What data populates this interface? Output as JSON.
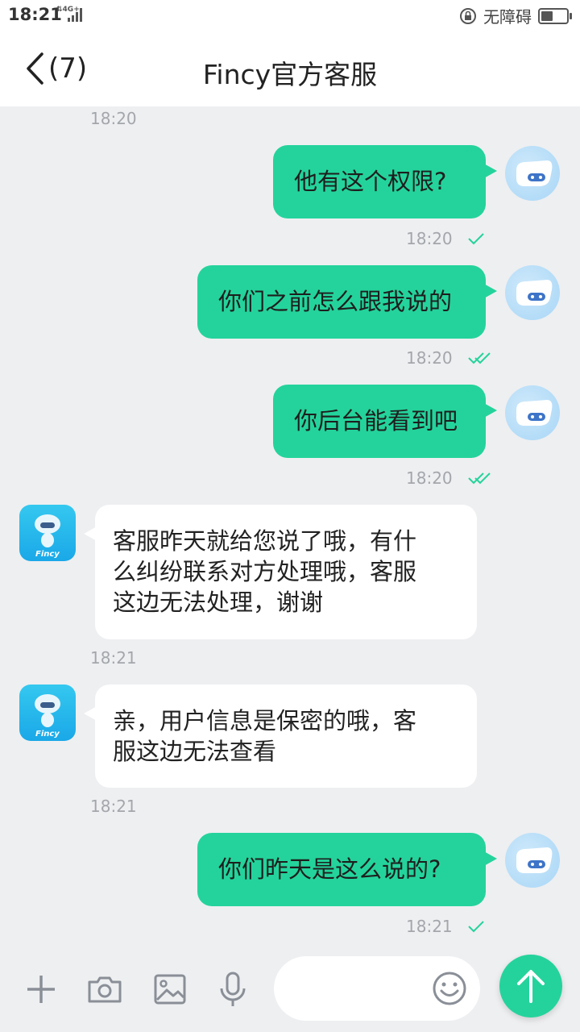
{
  "status_bar": {
    "time": "18:21",
    "network": "4G+",
    "accessibility": "无障碍"
  },
  "header": {
    "unread_count": "(7)",
    "title": "Fincy官方客服"
  },
  "messages": [
    {
      "from": "bot",
      "time": "18:20"
    },
    {
      "from": "me",
      "text": "他有这个权限?",
      "time": "18:20",
      "status": "delivered"
    },
    {
      "from": "me",
      "text": "你们之前怎么跟我说的",
      "time": "18:20",
      "status": "read"
    },
    {
      "from": "me",
      "text": "你后台能看到吧",
      "time": "18:20",
      "status": "read"
    },
    {
      "from": "bot",
      "lines": [
        "客服昨天就给您说了哦，有什",
        "么纠纷联系对方处理哦，客服",
        "这边无法处理，谢谢"
      ],
      "time": "18:21"
    },
    {
      "from": "bot",
      "lines": [
        "亲，用户信息是保密的哦，客",
        "服这边无法查看"
      ],
      "time": "18:21"
    },
    {
      "from": "me",
      "text": "你们昨天是这么说的?",
      "time": "18:21",
      "status": "delivered"
    }
  ],
  "bot_avatar_text": "Fincy",
  "bottom_bar": {
    "icons": [
      "plus-icon",
      "camera-icon",
      "image-icon",
      "microphone-icon",
      "emoji-icon",
      "send-icon"
    ]
  },
  "colors": {
    "accent": "#24d39b",
    "background": "#eeeff1",
    "incoming_bubble": "#ffffff"
  }
}
